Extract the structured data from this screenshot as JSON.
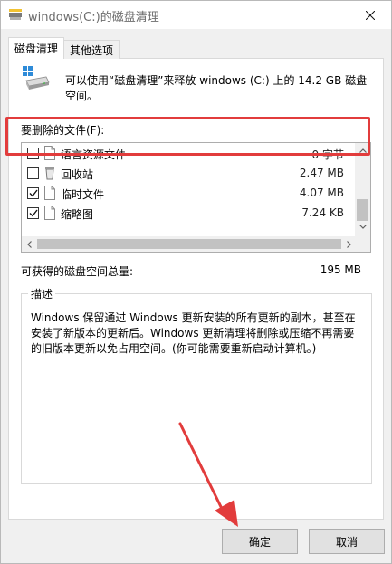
{
  "window": {
    "title": "windows(C:)的磁盘清理"
  },
  "tabs": [
    {
      "label": "磁盘清理",
      "active": true
    },
    {
      "label": "其他选项",
      "active": false
    }
  ],
  "intro_text": "可以使用“磁盘清理”来释放 windows (C:) 上的 14.2 GB 磁盘空间。",
  "files_label": "要删除的文件(F):",
  "files": [
    {
      "name": "语言资源文件",
      "size": "0 字节",
      "checked": false
    },
    {
      "name": "回收站",
      "size": "2.47 MB",
      "checked": false
    },
    {
      "name": "临时文件",
      "size": "4.07 MB",
      "checked": true
    },
    {
      "name": "缩略图",
      "size": "7.24 KB",
      "checked": true
    }
  ],
  "total": {
    "label": "可获得的磁盘空间总量:",
    "value": "195 MB"
  },
  "description": {
    "title": "描述",
    "text": "Windows 保留通过 Windows 更新安装的所有更新的副本，甚至在安装了新版本的更新后。Windows 更新清理将删除或压缩不再需要的旧版本更新以免占用空间。(你可能需要重新启动计算机。)"
  },
  "buttons": {
    "ok": "确定",
    "cancel": "取消"
  },
  "colors": {
    "annotation_red": "#e23c3c",
    "window_bg": "#f0f0f0"
  }
}
